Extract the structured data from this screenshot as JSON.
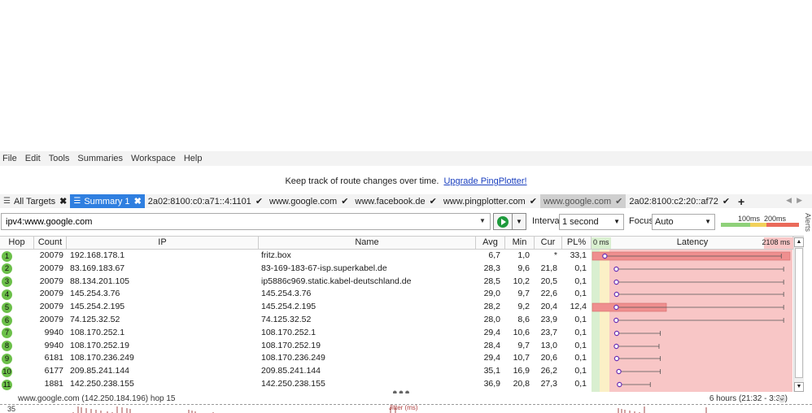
{
  "menu": [
    "File",
    "Edit",
    "Tools",
    "Summaries",
    "Workspace",
    "Help"
  ],
  "banner": {
    "text": "Keep track of route changes over time.",
    "link": "Upgrade PingPlotter!"
  },
  "tabs": [
    {
      "label": "All Targets",
      "icon": "list-icon",
      "suffix": "close",
      "style": "normal"
    },
    {
      "label": "Summary 1",
      "icon": "list-icon",
      "suffix": "close",
      "style": "active"
    },
    {
      "label": "2a02:8100:c0:a71::4:1101",
      "suffix": "check",
      "style": "normal"
    },
    {
      "label": "www.google.com",
      "suffix": "check",
      "style": "normal"
    },
    {
      "label": "www.facebook.de",
      "suffix": "check",
      "style": "normal"
    },
    {
      "label": "www.pingplotter.com",
      "suffix": "check",
      "style": "normal"
    },
    {
      "label": "www.google.com",
      "suffix": "check",
      "style": "gray"
    },
    {
      "label": "2a02:8100:c2:20::af72",
      "suffix": "check",
      "style": "normal"
    }
  ],
  "toolbar": {
    "target_value": "ipv4:www.google.com",
    "interval_label": "Interval",
    "interval_value": "1 second",
    "focus_label": "Focus",
    "focus_value": "Auto",
    "legend_100": "100ms",
    "legend_200": "200ms",
    "alerts_label": "Alerts"
  },
  "columns": {
    "hop": "Hop",
    "count": "Count",
    "ip": "IP",
    "name": "Name",
    "avg": "Avg",
    "min": "Min",
    "cur": "Cur",
    "pl": "PL%",
    "latency": "Latency",
    "lat_min": "0 ms",
    "lat_max": "2108 ms"
  },
  "rows": [
    {
      "hop": "1",
      "count": "20079",
      "ip": "192.168.178.1",
      "name": "fritz.box",
      "avg": "6,7",
      "min": "1,0",
      "cur": "*",
      "pl": "33,1",
      "pl_value": 33.1,
      "avg_ms": 6.7,
      "max_ms": 1990
    },
    {
      "hop": "2",
      "count": "20079",
      "ip": "83.169.183.67",
      "name": "83-169-183-67-isp.superkabel.de",
      "avg": "28,3",
      "min": "9,6",
      "cur": "21,8",
      "pl": "0,1",
      "pl_value": 0.1,
      "avg_ms": 28.3,
      "max_ms": 2040
    },
    {
      "hop": "3",
      "count": "20079",
      "ip": "88.134.201.105",
      "name": "ip5886c969.static.kabel-deutschland.de",
      "avg": "28,5",
      "min": "10,2",
      "cur": "20,5",
      "pl": "0,1",
      "pl_value": 0.1,
      "avg_ms": 28.5,
      "max_ms": 2040
    },
    {
      "hop": "4",
      "count": "20079",
      "ip": "145.254.3.76",
      "name": "145.254.3.76",
      "avg": "29,0",
      "min": "9,7",
      "cur": "22,6",
      "pl": "0,1",
      "pl_value": 0.1,
      "avg_ms": 29.0,
      "max_ms": 2040
    },
    {
      "hop": "5",
      "count": "20079",
      "ip": "145.254.2.195",
      "name": "145.254.2.195",
      "avg": "28,2",
      "min": "9,2",
      "cur": "20,4",
      "pl": "12,4",
      "pl_value": 12.4,
      "avg_ms": 28.2,
      "max_ms": 2040
    },
    {
      "hop": "6",
      "count": "20079",
      "ip": "74.125.32.52",
      "name": "74.125.32.52",
      "avg": "28,0",
      "min": "8,6",
      "cur": "23,9",
      "pl": "0,1",
      "pl_value": 0.1,
      "avg_ms": 28.0,
      "max_ms": 2040
    },
    {
      "hop": "7",
      "count": "9940",
      "ip": "108.170.252.1",
      "name": "108.170.252.1",
      "avg": "29,4",
      "min": "10,6",
      "cur": "23,7",
      "pl": "0,1",
      "pl_value": 0.1,
      "avg_ms": 29.4,
      "max_ms": 250
    },
    {
      "hop": "8",
      "count": "9940",
      "ip": "108.170.252.19",
      "name": "108.170.252.19",
      "avg": "28,4",
      "min": "9,7",
      "cur": "13,0",
      "pl": "0,1",
      "pl_value": 0.1,
      "avg_ms": 28.4,
      "max_ms": 240
    },
    {
      "hop": "9",
      "count": "6181",
      "ip": "108.170.236.249",
      "name": "108.170.236.249",
      "avg": "29,4",
      "min": "10,7",
      "cur": "20,6",
      "pl": "0,1",
      "pl_value": 0.1,
      "avg_ms": 29.4,
      "max_ms": 250
    },
    {
      "hop": "10",
      "count": "6177",
      "ip": "209.85.241.144",
      "name": "209.85.241.144",
      "avg": "35,1",
      "min": "16,9",
      "cur": "26,2",
      "pl": "0,1",
      "pl_value": 0.1,
      "avg_ms": 35.1,
      "max_ms": 250
    },
    {
      "hop": "11",
      "count": "1881",
      "ip": "142.250.238.155",
      "name": "142.250.238.155",
      "avg": "36,9",
      "min": "20,8",
      "cur": "27,3",
      "pl": "0,1",
      "pl_value": 0.1,
      "avg_ms": 36.9,
      "max_ms": 180
    }
  ],
  "latency_scale_max_ms": 2108,
  "footer": {
    "target": "www.google.com (142.250.184.196) hop 15",
    "range": "6 hours (21:32 - 3:32)"
  },
  "jitter": {
    "axis_value": "35",
    "label": "Jitter (ms)"
  },
  "colors": {
    "accent": "#2f7fe0",
    "hop_badge": "#6cc04a",
    "latency_bg": "#f8c6c6",
    "loss_bar": "#ef8f8f"
  }
}
